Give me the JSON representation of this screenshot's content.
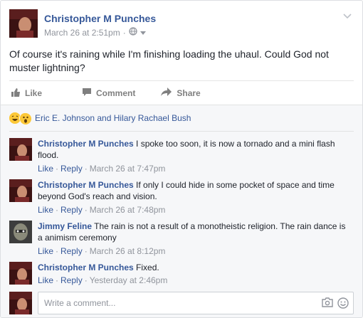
{
  "post": {
    "author": "Christopher M Punches",
    "timestamp": "March 26 at 2:51pm",
    "text": "Of course it's raining while I'm finishing loading the uhaul. Could God not muster lightning?"
  },
  "actions": {
    "like": "Like",
    "comment": "Comment",
    "share": "Share"
  },
  "reactions": {
    "icons": [
      "haha-icon",
      "wow-icon"
    ],
    "names": "Eric E. Johnson and Hilary Rachael Bush"
  },
  "comments": [
    {
      "author": "Christopher M Punches",
      "text": " I spoke too soon, it is now a tornado and a mini flash flood.",
      "like": "Like",
      "reply": "Reply",
      "time": "March 26 at 7:47pm"
    },
    {
      "author": "Christopher M Punches",
      "text": " If only I could hide in some pocket of space and time beyond God's reach and vision.",
      "like": "Like",
      "reply": "Reply",
      "time": "March 26 at 7:48pm"
    },
    {
      "author": "Jimmy Feline",
      "text": " The rain is not a result of a monotheistic religion. The rain dance is a animism ceremony",
      "like": "Like",
      "reply": "Reply",
      "time": "March 26 at 8:12pm"
    },
    {
      "author": "Christopher M Punches",
      "text": " Fixed.",
      "like": "Like",
      "reply": "Reply",
      "time": "Yesterday at 2:46pm"
    }
  ],
  "composer": {
    "placeholder": "Write a comment..."
  },
  "colors": {
    "link": "#365899",
    "meta": "#90949c",
    "feedback_bg": "#f6f7f9"
  }
}
